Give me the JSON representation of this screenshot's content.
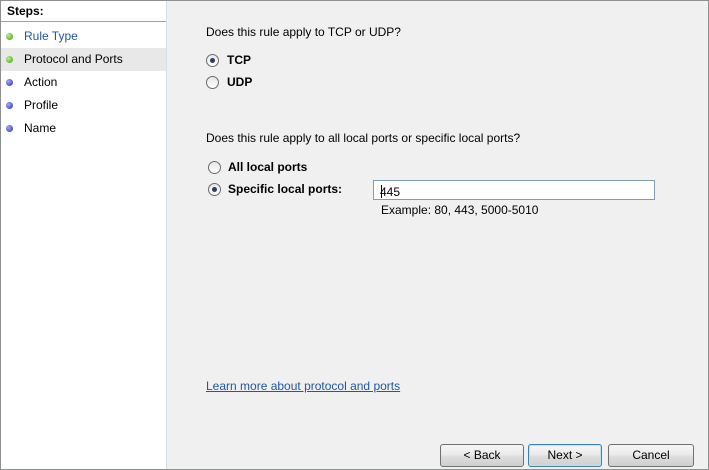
{
  "sidebar": {
    "header": "Steps:",
    "items": [
      {
        "label": "Rule Type",
        "status": "completed",
        "dot_color": "#3f9b14",
        "is_link": true
      },
      {
        "label": "Protocol and Ports",
        "status": "current",
        "dot_color": "#3f9b14",
        "is_link": false
      },
      {
        "label": "Action",
        "status": "pending",
        "dot_color": "#2b2fa8",
        "is_link": false
      },
      {
        "label": "Profile",
        "status": "pending",
        "dot_color": "#2b2fa8",
        "is_link": false
      },
      {
        "label": "Name",
        "status": "pending",
        "dot_color": "#2b2fa8",
        "is_link": false
      }
    ]
  },
  "protocol": {
    "question": "Does this rule apply to TCP or UDP?",
    "options": [
      {
        "label": "TCP",
        "selected": true
      },
      {
        "label": "UDP",
        "selected": false
      }
    ]
  },
  "ports": {
    "question": "Does this rule apply to all local ports or specific local ports?",
    "options": [
      {
        "label": "All local ports",
        "selected": false
      },
      {
        "label": "Specific local ports:",
        "selected": true
      }
    ],
    "input_value": "445",
    "example": "Example: 80, 443, 5000-5010"
  },
  "learn_more": "Learn more about protocol and ports",
  "buttons": {
    "back": "< Back",
    "next": "Next >",
    "cancel": "Cancel"
  },
  "colors": {
    "link": "#1f57a4",
    "completed_dot": "#3f9b14",
    "pending_dot": "#2b2fa8"
  }
}
